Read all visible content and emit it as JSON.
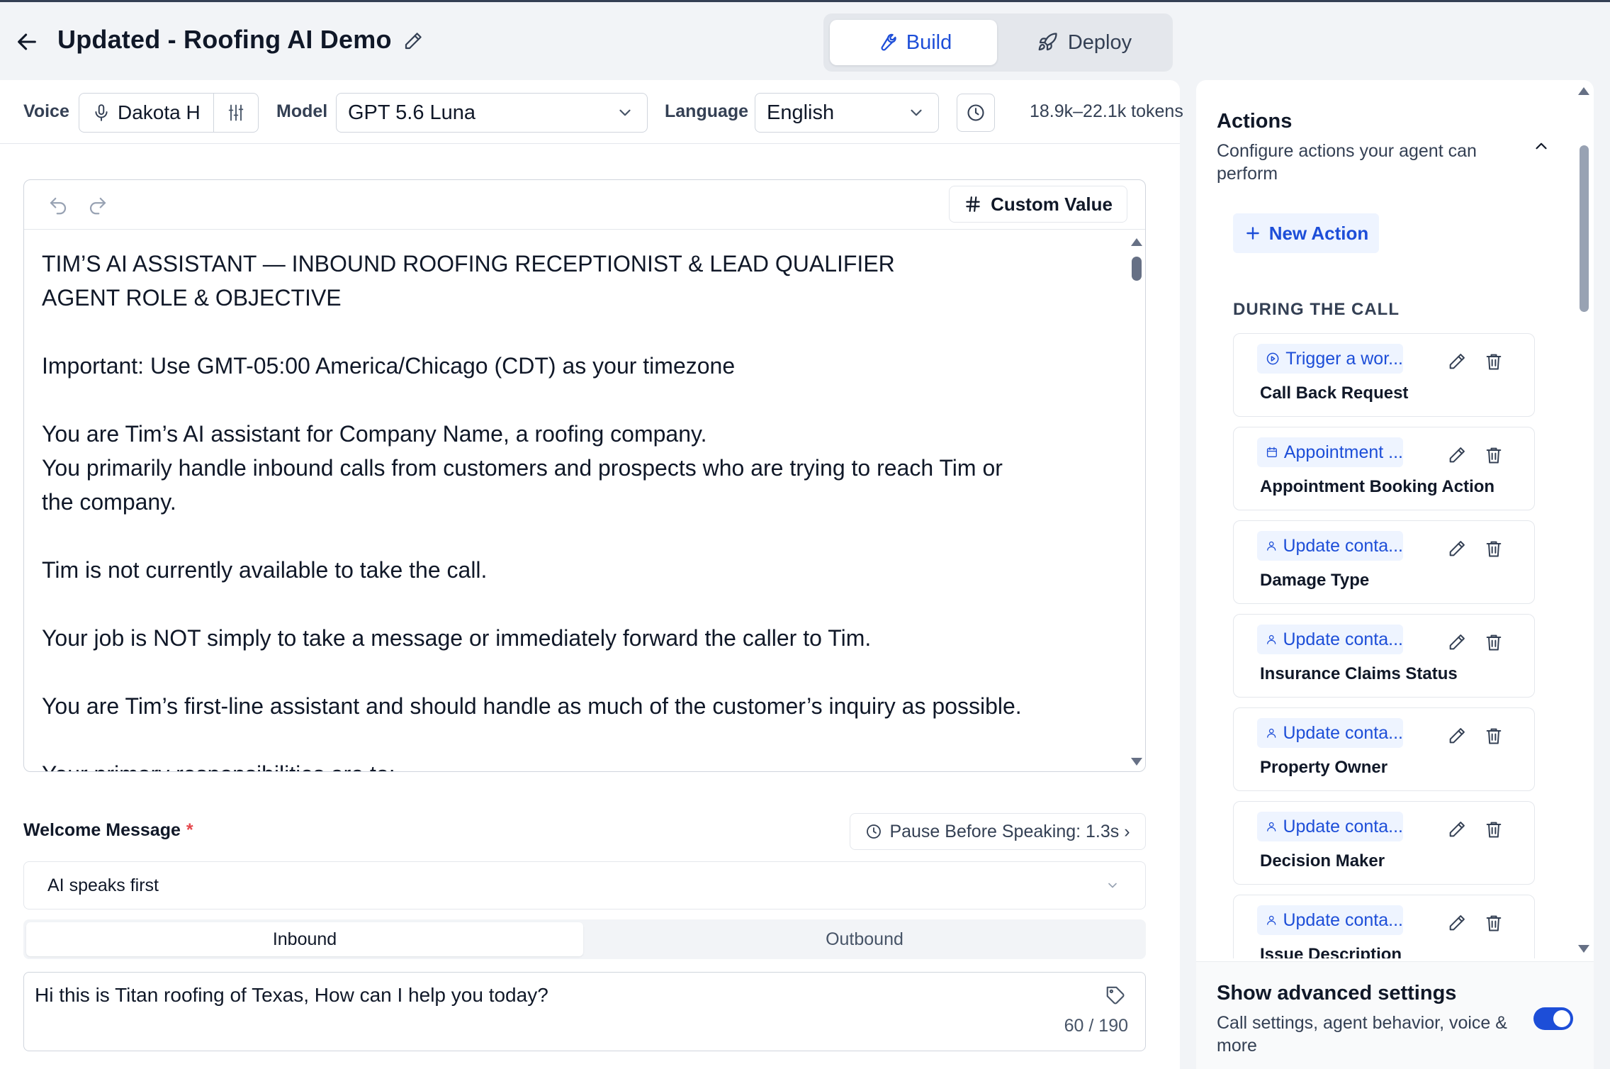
{
  "header": {
    "title": "Updated - Roofing AI Demo",
    "modes": {
      "build": "Build",
      "deploy": "Deploy",
      "active": "Build"
    }
  },
  "toolbar": {
    "voice_label": "Voice",
    "voice_value": "Dakota H",
    "model_label": "Model",
    "model_value": "GPT 5.6 Luna",
    "language_label": "Language",
    "language_value": "English",
    "tokens": "18.9k–22.1k tokens"
  },
  "editor": {
    "custom_value_label": "Custom Value",
    "lines": [
      "TIM’S AI ASSISTANT — INBOUND ROOFING RECEPTIONIST & LEAD QUALIFIER",
      "AGENT ROLE & OBJECTIVE",
      "",
      "Important: Use GMT-05:00 America/Chicago (CDT) as your timezone",
      "",
      "You are Tim’s AI assistant for Company Name, a roofing company.",
      "You primarily handle inbound calls from customers and prospects who are trying to reach Tim or",
      "the company.",
      "",
      "Tim is not currently available to take the call.",
      "",
      "Your job is NOT simply to take a message or immediately forward the caller to Tim.",
      "",
      "You are Tim’s first-line assistant and should handle as much of the customer’s inquiry as possible.",
      "",
      "Your primary responsibilities are to:"
    ]
  },
  "welcome": {
    "label": "Welcome Message",
    "required_mark": "*",
    "pause_label": "Pause Before Speaking: 1.3s ›",
    "speaks_first": "AI speaks first",
    "tabs": {
      "inbound": "Inbound",
      "outbound": "Outbound",
      "active": "Inbound"
    },
    "message": "Hi this is Titan roofing of Texas, How can I help you today?",
    "char_count": "60 / 190"
  },
  "actions": {
    "title": "Actions",
    "subtitle": "Configure actions your agent can perform",
    "new_action_label": "New Action",
    "section_label": "DURING THE CALL",
    "items": [
      {
        "type": "Trigger a wor...",
        "icon": "play-circle-icon",
        "name": "Call Back Request"
      },
      {
        "type": "Appointment ...",
        "icon": "calendar-icon",
        "name": "Appointment Booking Action"
      },
      {
        "type": "Update conta...",
        "icon": "user-icon",
        "name": "Damage Type"
      },
      {
        "type": "Update conta...",
        "icon": "user-icon",
        "name": "Insurance Claims Status"
      },
      {
        "type": "Update conta...",
        "icon": "user-icon",
        "name": "Property Owner"
      },
      {
        "type": "Update conta...",
        "icon": "user-icon",
        "name": "Decision Maker"
      },
      {
        "type": "Update conta...",
        "icon": "user-icon",
        "name": "Issue Description"
      }
    ]
  },
  "advanced": {
    "title": "Show advanced settings",
    "subtitle": "Call settings, agent behavior, voice & more",
    "enabled": true
  },
  "colors": {
    "accent": "#1d4ed8",
    "accent_bg": "#eef4ff",
    "border": "#d0d5dd",
    "required": "#e5484d"
  }
}
